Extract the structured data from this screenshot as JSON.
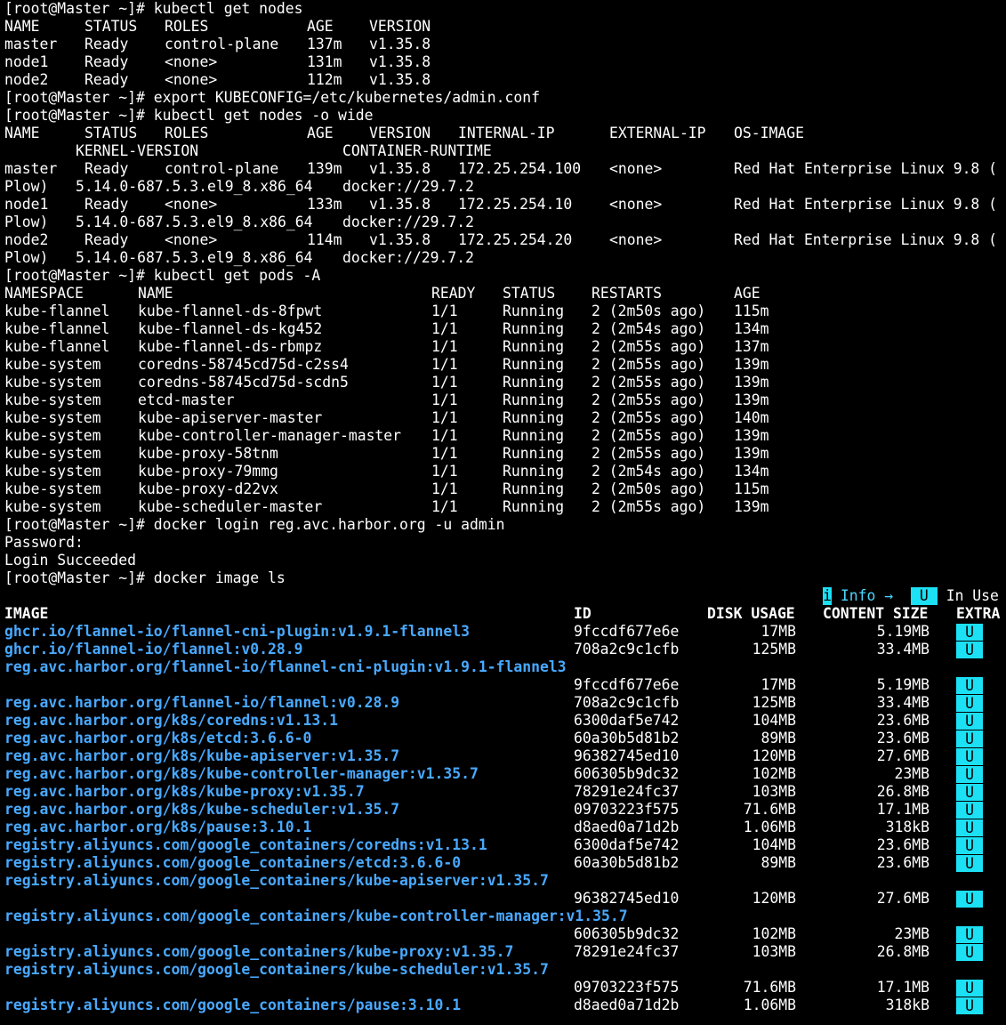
{
  "colors": {
    "background": "#000000",
    "foreground": "#ffffff",
    "image_name": "#49a9ff",
    "in_use_badge": "#1ce0f4",
    "legend_text": "#49d6ff"
  },
  "prompt": "[root@Master ~]# ",
  "commands": {
    "get_nodes": "kubectl get nodes",
    "export_kubeconfig": "export KUBECONFIG=/etc/kubernetes/admin.conf",
    "get_nodes_wide": "kubectl get nodes -o wide",
    "get_pods": "kubectl get pods -A",
    "docker_login": "docker login reg.avc.harbor.org -u admin",
    "docker_image_ls": "docker image ls"
  },
  "nodes": {
    "headers": [
      "NAME",
      "STATUS",
      "ROLES",
      "AGE",
      "VERSION"
    ],
    "rows": [
      [
        "master",
        "Ready",
        "control-plane",
        "137m",
        "v1.35.8"
      ],
      [
        "node1",
        "Ready",
        "<none>",
        "131m",
        "v1.35.8"
      ],
      [
        "node2",
        "Ready",
        "<none>",
        "112m",
        "v1.35.8"
      ]
    ]
  },
  "nodes_wide": {
    "headers": [
      "NAME",
      "STATUS",
      "ROLES",
      "AGE",
      "VERSION",
      "INTERNAL-IP",
      "EXTERNAL-IP",
      "OS-IMAGE"
    ],
    "headers_wrapped": [
      "KERNEL-VERSION",
      "CONTAINER-RUNTIME"
    ],
    "rows": [
      {
        "cols": [
          "master",
          "Ready",
          "control-plane",
          "139m",
          "v1.35.8",
          "172.25.254.100",
          "<none>",
          "Red Hat Enterprise Linux 9.8 ("
        ],
        "wrap": [
          "Plow)",
          "5.14.0-687.5.3.el9_8.x86_64",
          "docker://29.7.2"
        ]
      },
      {
        "cols": [
          "node1",
          "Ready",
          "<none>",
          "133m",
          "v1.35.8",
          "172.25.254.10",
          "<none>",
          "Red Hat Enterprise Linux 9.8 ("
        ],
        "wrap": [
          "Plow)",
          "5.14.0-687.5.3.el9_8.x86_64",
          "docker://29.7.2"
        ]
      },
      {
        "cols": [
          "node2",
          "Ready",
          "<none>",
          "114m",
          "v1.35.8",
          "172.25.254.20",
          "<none>",
          "Red Hat Enterprise Linux 9.8 ("
        ],
        "wrap": [
          "Plow)",
          "5.14.0-687.5.3.el9_8.x86_64",
          "docker://29.7.2"
        ]
      }
    ]
  },
  "pods": {
    "headers": [
      "NAMESPACE",
      "NAME",
      "READY",
      "STATUS",
      "RESTARTS",
      "AGE"
    ],
    "rows": [
      [
        "kube-flannel",
        "kube-flannel-ds-8fpwt",
        "1/1",
        "Running",
        "2 (2m50s ago)",
        "115m"
      ],
      [
        "kube-flannel",
        "kube-flannel-ds-kg452",
        "1/1",
        "Running",
        "2 (2m54s ago)",
        "134m"
      ],
      [
        "kube-flannel",
        "kube-flannel-ds-rbmpz",
        "1/1",
        "Running",
        "2 (2m55s ago)",
        "137m"
      ],
      [
        "kube-system",
        "coredns-58745cd75d-c2ss4",
        "1/1",
        "Running",
        "2 (2m55s ago)",
        "139m"
      ],
      [
        "kube-system",
        "coredns-58745cd75d-scdn5",
        "1/1",
        "Running",
        "2 (2m55s ago)",
        "139m"
      ],
      [
        "kube-system",
        "etcd-master",
        "1/1",
        "Running",
        "2 (2m55s ago)",
        "139m"
      ],
      [
        "kube-system",
        "kube-apiserver-master",
        "1/1",
        "Running",
        "2 (2m55s ago)",
        "140m"
      ],
      [
        "kube-system",
        "kube-controller-manager-master",
        "1/1",
        "Running",
        "2 (2m55s ago)",
        "139m"
      ],
      [
        "kube-system",
        "kube-proxy-58tnm",
        "1/1",
        "Running",
        "2 (2m55s ago)",
        "139m"
      ],
      [
        "kube-system",
        "kube-proxy-79mmg",
        "1/1",
        "Running",
        "2 (2m54s ago)",
        "134m"
      ],
      [
        "kube-system",
        "kube-proxy-d22vx",
        "1/1",
        "Running",
        "2 (2m50s ago)",
        "115m"
      ],
      [
        "kube-system",
        "kube-scheduler-master",
        "1/1",
        "Running",
        "2 (2m55s ago)",
        "139m"
      ]
    ]
  },
  "login": {
    "password_prompt": "Password:",
    "result": "Login Succeeded"
  },
  "images": {
    "legend": {
      "info_icon": "i",
      "info_label": "Info →",
      "badge": "U",
      "badge_label": "In Use"
    },
    "headers": [
      "IMAGE",
      "ID",
      "DISK USAGE",
      "CONTENT SIZE",
      "EXTRA"
    ],
    "rows": [
      {
        "image": "ghcr.io/flannel-io/flannel-cni-plugin:v1.9.1-flannel3",
        "id": "9fccdf677e6e",
        "disk": "17MB",
        "content": "5.19MB",
        "extra": "U",
        "wrapped": false
      },
      {
        "image": "ghcr.io/flannel-io/flannel:v0.28.9",
        "id": "708a2c9c1cfb",
        "disk": "125MB",
        "content": "33.4MB",
        "extra": "U",
        "wrapped": false
      },
      {
        "image": "reg.avc.harbor.org/flannel-io/flannel-cni-plugin:v1.9.1-flannel3",
        "id": "9fccdf677e6e",
        "disk": "17MB",
        "content": "5.19MB",
        "extra": "U",
        "wrapped": true
      },
      {
        "image": "reg.avc.harbor.org/flannel-io/flannel:v0.28.9",
        "id": "708a2c9c1cfb",
        "disk": "125MB",
        "content": "33.4MB",
        "extra": "U",
        "wrapped": false
      },
      {
        "image": "reg.avc.harbor.org/k8s/coredns:v1.13.1",
        "id": "6300daf5e742",
        "disk": "104MB",
        "content": "23.6MB",
        "extra": "U",
        "wrapped": false
      },
      {
        "image": "reg.avc.harbor.org/k8s/etcd:3.6.6-0",
        "id": "60a30b5d81b2",
        "disk": "89MB",
        "content": "23.6MB",
        "extra": "U",
        "wrapped": false
      },
      {
        "image": "reg.avc.harbor.org/k8s/kube-apiserver:v1.35.7",
        "id": "96382745ed10",
        "disk": "120MB",
        "content": "27.6MB",
        "extra": "U",
        "wrapped": false
      },
      {
        "image": "reg.avc.harbor.org/k8s/kube-controller-manager:v1.35.7",
        "id": "606305b9dc32",
        "disk": "102MB",
        "content": "23MB",
        "extra": "U",
        "wrapped": false
      },
      {
        "image": "reg.avc.harbor.org/k8s/kube-proxy:v1.35.7",
        "id": "78291e24fc37",
        "disk": "103MB",
        "content": "26.8MB",
        "extra": "U",
        "wrapped": false
      },
      {
        "image": "reg.avc.harbor.org/k8s/kube-scheduler:v1.35.7",
        "id": "09703223f575",
        "disk": "71.6MB",
        "content": "17.1MB",
        "extra": "U",
        "wrapped": false
      },
      {
        "image": "reg.avc.harbor.org/k8s/pause:3.10.1",
        "id": "d8aed0a71d2b",
        "disk": "1.06MB",
        "content": "318kB",
        "extra": "U",
        "wrapped": false
      },
      {
        "image": "registry.aliyuncs.com/google_containers/coredns:v1.13.1",
        "id": "6300daf5e742",
        "disk": "104MB",
        "content": "23.6MB",
        "extra": "U",
        "wrapped": false
      },
      {
        "image": "registry.aliyuncs.com/google_containers/etcd:3.6.6-0",
        "id": "60a30b5d81b2",
        "disk": "89MB",
        "content": "23.6MB",
        "extra": "U",
        "wrapped": false
      },
      {
        "image": "registry.aliyuncs.com/google_containers/kube-apiserver:v1.35.7",
        "id": "96382745ed10",
        "disk": "120MB",
        "content": "27.6MB",
        "extra": "U",
        "wrapped": true
      },
      {
        "image": "registry.aliyuncs.com/google_containers/kube-controller-manager:v1.35.7",
        "id": "606305b9dc32",
        "disk": "102MB",
        "content": "23MB",
        "extra": "U",
        "wrapped": true
      },
      {
        "image": "registry.aliyuncs.com/google_containers/kube-proxy:v1.35.7",
        "id": "78291e24fc37",
        "disk": "103MB",
        "content": "26.8MB",
        "extra": "U",
        "wrapped": false
      },
      {
        "image": "registry.aliyuncs.com/google_containers/kube-scheduler:v1.35.7",
        "id": "09703223f575",
        "disk": "71.6MB",
        "content": "17.1MB",
        "extra": "U",
        "wrapped": true
      },
      {
        "image": "registry.aliyuncs.com/google_containers/pause:3.10.1",
        "id": "d8aed0a71d2b",
        "disk": "1.06MB",
        "content": "318kB",
        "extra": "U",
        "wrapped": false
      }
    ]
  }
}
